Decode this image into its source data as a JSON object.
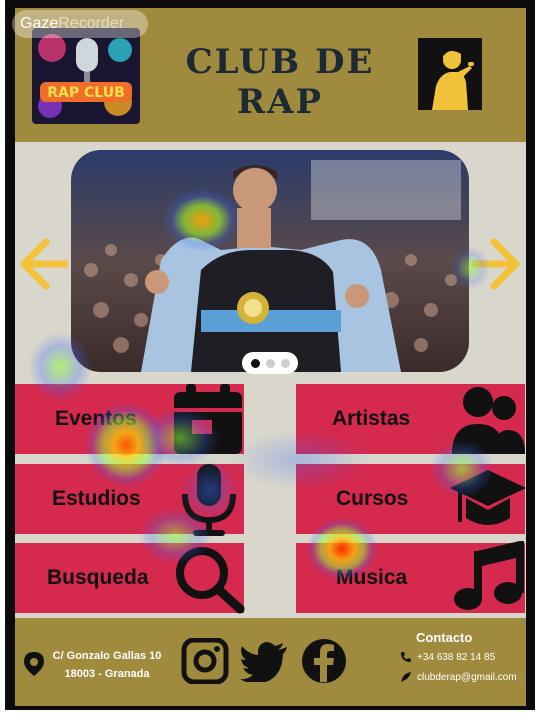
{
  "watermark": {
    "part1": "Gaze",
    "part2": "Recorder"
  },
  "header": {
    "title": "CLUB DE RAP",
    "logo_text": "RAP CLUB"
  },
  "colors": {
    "header_bg": "#a08a3e",
    "main_bg": "#d9d6cb",
    "tile": "#d5294d",
    "arrow": "#f2c23a",
    "frame": "#0b0b0b"
  },
  "carousel": {
    "slide_count": 3,
    "active_slide": 1
  },
  "menu": {
    "left": [
      {
        "label": "Eventos",
        "icon": "calendar-icon"
      },
      {
        "label": "Estudios",
        "icon": "microphone-icon"
      },
      {
        "label": "Busqueda",
        "icon": "search-icon"
      }
    ],
    "right": [
      {
        "label": "Artistas",
        "icon": "users-icon"
      },
      {
        "label": "Cursos",
        "icon": "graduation-cap-icon"
      },
      {
        "label": "Musica",
        "icon": "music-note-icon"
      }
    ]
  },
  "footer": {
    "address_line1": "C/ Gonzalo Gallas 10",
    "address_line2": "18003 - Granada",
    "social": [
      "instagram-icon",
      "twitter-icon",
      "facebook-icon"
    ],
    "contact_title": "Contacto",
    "phone": "+34 638 82 14 85",
    "email": "clubderap@gmail.com"
  }
}
